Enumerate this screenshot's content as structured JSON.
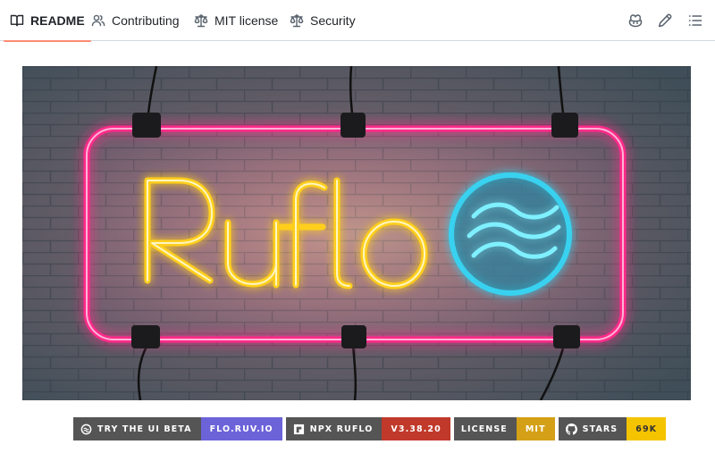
{
  "tabs": [
    {
      "label": "README",
      "icon": "book-icon",
      "active": true
    },
    {
      "label": "Contributing",
      "icon": "people-icon",
      "active": false
    },
    {
      "label": "MIT license",
      "icon": "law-scale-icon",
      "active": false
    },
    {
      "label": "Security",
      "icon": "law-scale-icon",
      "active": false
    }
  ],
  "toolbar": {
    "icons": [
      "copilot-icon",
      "pencil-icon",
      "outline-list-icon"
    ]
  },
  "banner": {
    "sign_text": "Ruflo",
    "colors": {
      "frame": "#ff2a8a",
      "letters": "#ffcf1f",
      "logo": "#39d2f0",
      "wall": "#525e66"
    }
  },
  "badges": [
    {
      "label": "TRY THE UI BETA",
      "value": "FLO.RUV.IO",
      "icon": "flo-logo-icon",
      "color": "#6c63d9"
    },
    {
      "label": "NPX RUFLO",
      "value": "V3.38.20",
      "icon": "npm-icon",
      "color": "#c0392b"
    },
    {
      "label": "LICENSE",
      "value": "MIT",
      "icon": "",
      "color": "#d4a017"
    },
    {
      "label": "STARS",
      "value": "69K",
      "icon": "github-icon",
      "color": "#f5c400"
    }
  ]
}
